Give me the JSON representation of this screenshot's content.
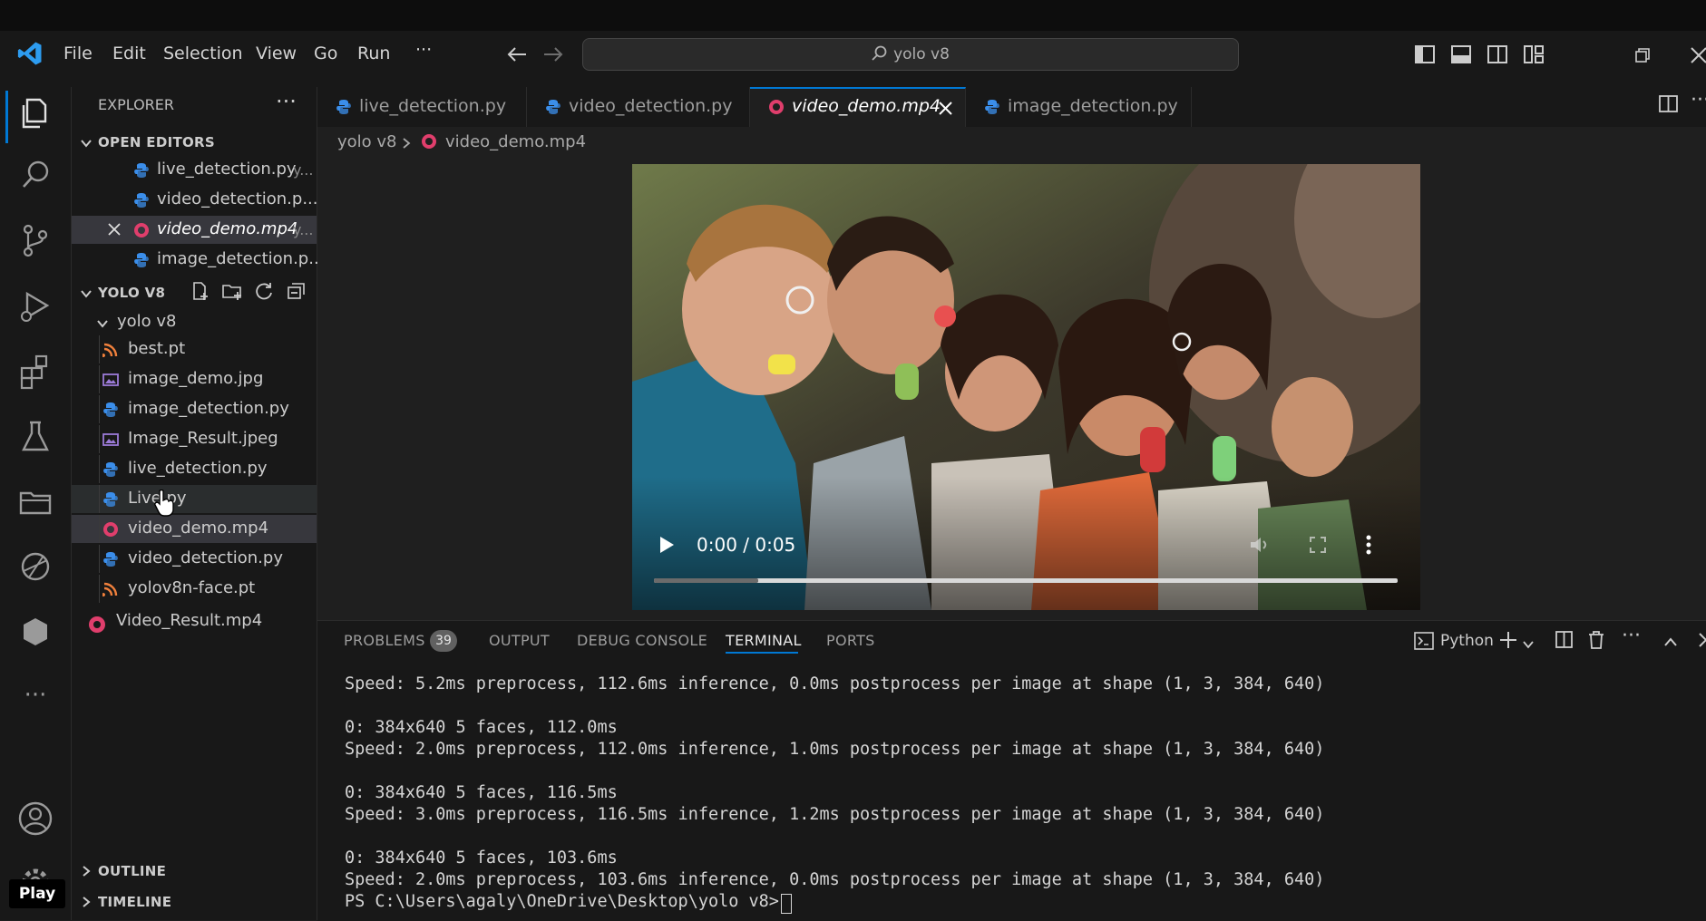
{
  "menu": [
    "File",
    "Edit",
    "Selection",
    "View",
    "Go",
    "Run",
    "···"
  ],
  "search": {
    "text": "yolo v8"
  },
  "sidebar": {
    "title": "EXPLORER",
    "open_editors_title": "OPEN EDITORS",
    "open_editors": [
      {
        "name": "live_detection.py",
        "hint": "y...",
        "kind": "py"
      },
      {
        "name": "video_detection.p...",
        "hint": "",
        "kind": "py"
      },
      {
        "name": "video_demo.mp4",
        "hint": "y...",
        "kind": "mp4"
      },
      {
        "name": "image_detection.p...",
        "hint": "",
        "kind": "py"
      }
    ],
    "project_title": "YOLO V8",
    "folder": "yolo v8",
    "files": [
      {
        "name": "best.pt",
        "kind": "pt"
      },
      {
        "name": "image_demo.jpg",
        "kind": "img"
      },
      {
        "name": "image_detection.py",
        "kind": "py"
      },
      {
        "name": "Image_Result.jpeg",
        "kind": "img"
      },
      {
        "name": "live_detection.py",
        "kind": "py"
      },
      {
        "name": "Live.py",
        "kind": "py"
      },
      {
        "name": "video_demo.mp4",
        "kind": "mp4"
      },
      {
        "name": "video_detection.py",
        "kind": "py"
      },
      {
        "name": "yolov8n-face.pt",
        "kind": "pt"
      }
    ],
    "root_file": "Video_Result.mp4",
    "outline": "OUTLINE",
    "timeline": "TIMELINE"
  },
  "tabs": [
    {
      "label": "live_detection.py",
      "active": false
    },
    {
      "label": "video_detection.py",
      "active": false
    },
    {
      "label": "video_demo.mp4",
      "active": true
    },
    {
      "label": "image_detection.py",
      "active": false
    }
  ],
  "breadcrumb": {
    "folder": "yolo v8",
    "file": "video_demo.mp4"
  },
  "video": {
    "time": "0:00 / 0:05",
    "progress": 0.14
  },
  "panel": {
    "tabs": [
      "PROBLEMS",
      "OUTPUT",
      "DEBUG CONSOLE",
      "TERMINAL",
      "PORTS"
    ],
    "problems_count": "39",
    "terminal_label": "Python",
    "lines": [
      "Speed: 5.2ms preprocess, 112.6ms inference, 0.0ms postprocess per image at shape (1, 3, 384, 640)",
      "",
      "0: 384x640 5 faces, 112.0ms",
      "Speed: 2.0ms preprocess, 112.0ms inference, 1.0ms postprocess per image at shape (1, 3, 384, 640)",
      "",
      "0: 384x640 5 faces, 116.5ms",
      "Speed: 3.0ms preprocess, 116.5ms inference, 1.2ms postprocess per image at shape (1, 3, 384, 640)",
      "",
      "0: 384x640 5 faces, 103.6ms",
      "Speed: 2.0ms preprocess, 103.6ms inference, 0.0ms postprocess per image at shape (1, 3, 384, 640)",
      "PS C:\\Users\\agaly\\OneDrive\\Desktop\\yolo v8> "
    ]
  },
  "overlay": {
    "play_badge": "Play"
  },
  "colors": {
    "accent": "#0078d4",
    "python": "#3b8eea",
    "mp4": "#e03e6c",
    "pt": "#f0803c",
    "image": "#9c7bd8"
  }
}
